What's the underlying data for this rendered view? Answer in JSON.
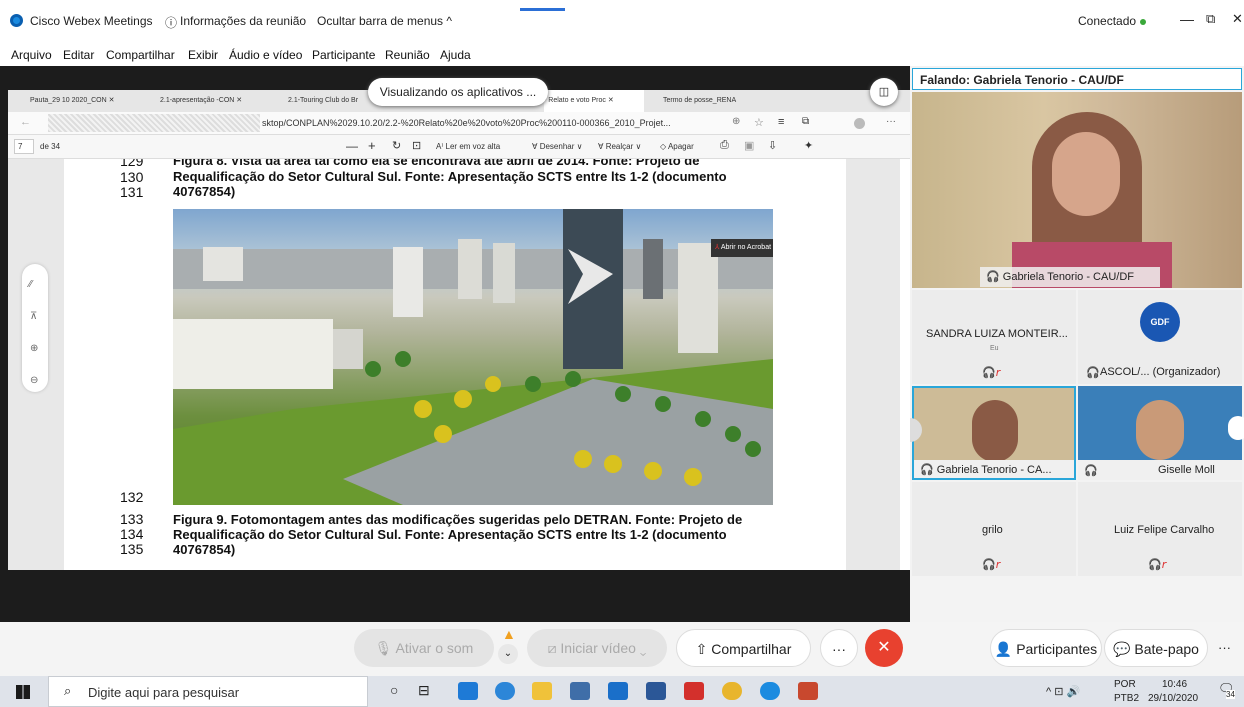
{
  "titlebar": {
    "app": "Cisco Webex Meetings",
    "meeting_info": "Informações da reunião",
    "hide_menu": "Ocultar barra de menus ^",
    "status": "Conectado",
    "status_color": "#3aa83a"
  },
  "menu": [
    "Arquivo",
    "Editar",
    "Compartilhar",
    "Exibir",
    "Áudio e vídeo",
    "Participante",
    "Reunião",
    "Ajuda"
  ],
  "share": {
    "viewing_label": "Visualizando os aplicativos ..."
  },
  "browser": {
    "tabs": [
      "Pauta_29 10 2020_CON",
      "2.1-apresentação -CON",
      "2.1-Touring Club do Br",
      "- Relato e voto Proc",
      "Termo de posse_RENA"
    ],
    "url": "sktop/CONPLAN%2029.10.20/2.2-%20Relato%20e%20voto%20Proc%200110-000366_2010_Projet...",
    "page_current": "7",
    "page_total": "de 34",
    "pdf_tools": [
      "Ler em voz alta",
      "Desenhar",
      "Realçar",
      "Apagar"
    ]
  },
  "document": {
    "line_top": "129",
    "caption8_line1": "Figura 8. Vista da área tal como ela se encontrava até abril de 2014. Fonte: Projeto de",
    "line130": "130",
    "caption8_line2": "Requalificação do Setor Cultural Sul. Fonte: Apresentação SCTS entre lts 1-2 (documento",
    "line131": "131",
    "caption8_line3": "40767854)",
    "acrobat_label": "Abrir no Acrobat",
    "line132": "132",
    "line133": "133",
    "caption9_line1": "Figura 9. Fotomontagem antes das modificações sugeridas pelo DETRAN. Fonte: Projeto de",
    "line134": "134",
    "caption9_line2": "Requalificação do Setor Cultural Sul. Fonte: Apresentação SCTS entre lts 1-2 (documento",
    "line135": "135",
    "caption9_line3": "40767854)"
  },
  "panel": {
    "speaking": "Falando: Gabriela Tenorio - CAU/DF",
    "main_video_name": "Gabriela Tenorio - CAU/DF",
    "participants": [
      {
        "name": "SANDRA LUIZA MONTEIR...",
        "sub": "Eu"
      },
      {
        "name": "ASCOL/... (Organizador)",
        "sub": "GDF"
      },
      {
        "name": "Gabriela Tenorio - CA...",
        "sub": ""
      },
      {
        "name": "Giselle Moll",
        "sub": ""
      },
      {
        "name": "grilo",
        "sub": ""
      },
      {
        "name": "Luiz Felipe Carvalho",
        "sub": ""
      }
    ]
  },
  "controls": {
    "mute": "Ativar o som",
    "video": "Iniciar vídeo",
    "share": "Compartilhar",
    "more": "···",
    "participants": "Participantes",
    "chat": "Bate-papo",
    "end_color": "#e8412f"
  },
  "taskbar": {
    "search": "Digite aqui para pesquisar",
    "lang1": "POR",
    "lang2": "PTB2",
    "time": "10:46",
    "date": "29/10/2020",
    "notif": "34"
  }
}
